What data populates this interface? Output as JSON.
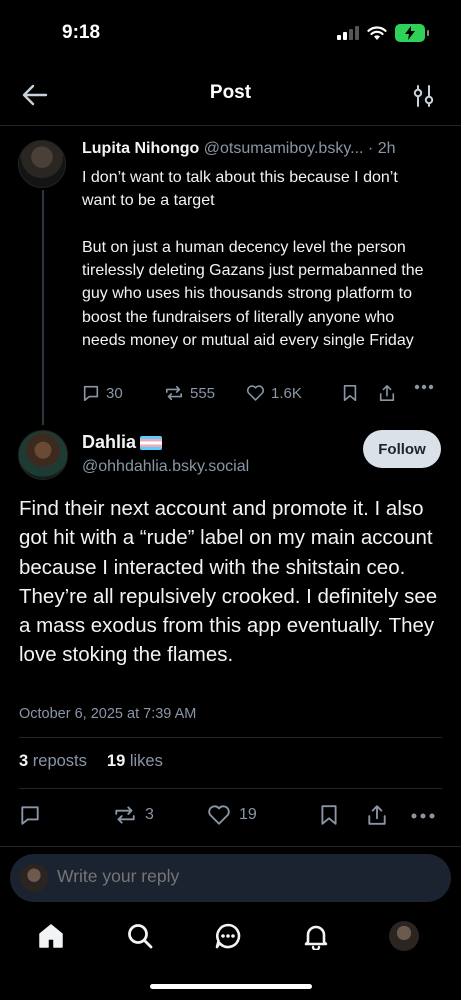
{
  "status_bar": {
    "time": "9:18"
  },
  "header": {
    "title": "Post"
  },
  "parent_post": {
    "author_name": "Lupita Nihongo",
    "author_handle": "@otsumamiboy.bsky...",
    "separator": "·",
    "time_ago": "2h",
    "body": "I don’t want to talk about this because I don’t want to be a target\n\nBut on just a human decency level the person tirelessly deleting Gazans just permabanned the guy who uses his thousands strong platform to boost the fundraisers of literally anyone who needs money or mutual aid every single Friday",
    "reply_count": "30",
    "repost_count": "555",
    "like_count": "1.6K"
  },
  "main_post": {
    "author_name": "Dahlia",
    "author_handle": "@ohhdahlia.bsky.social",
    "follow_label": "Follow",
    "body": "Find their next account and promote it. I also got hit with a “rude” label on my main account because I interacted with the shitstain ceo. They’re all repulsively crooked. I definitely see a mass exodus from this app eventually. They love stoking the flames.",
    "date": "October 6, 2025 at 7:39 AM",
    "reposts_count": "3",
    "reposts_label": "reposts",
    "likes_count": "19",
    "likes_label": "likes",
    "repost_count_action": "3",
    "like_count_action": "19"
  },
  "composer": {
    "placeholder": "Write your reply"
  },
  "colors": {
    "background": "#000000",
    "muted": "#8a96a6",
    "follow_bg": "#dbe1e8",
    "composer_bg": "#1b2330"
  }
}
